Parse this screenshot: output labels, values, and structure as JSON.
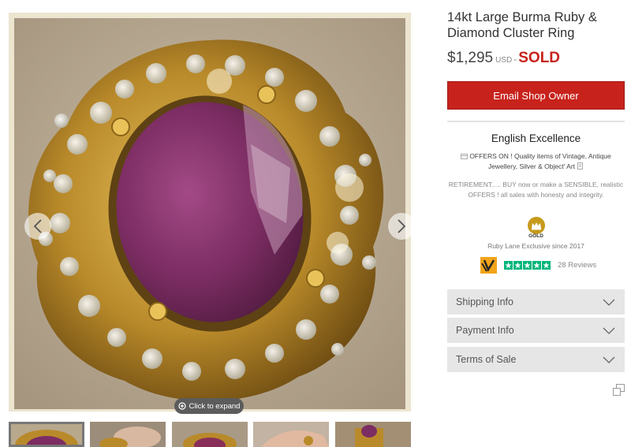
{
  "listing": {
    "title": "14kt Large Burma Ruby & Diamond Cluster Ring",
    "price": "$1,295",
    "currency": "USD",
    "separator": "-",
    "status": "SOLD",
    "email_button": "Email Shop Owner"
  },
  "gallery": {
    "expand_label": "Click to expand",
    "prev_icon": "chevron-left-icon",
    "next_icon": "chevron-right-icon",
    "thumbnail_count": 5,
    "active_thumbnail": 1
  },
  "shop": {
    "name": "English Excellence",
    "tagline": "OFFERS ON ! Quality items of Vintage, Antique Jewellery, Silver & Object' Art",
    "description": "RETIREMENT..... BUY now or make a SENSIBLE, realistic OFFERS ! all sales with honesty and integrity.",
    "badge": "GOLD",
    "badge_icon": "crown-icon",
    "exclusive": "Ruby Lane Exclusive since 2017",
    "rating_stars": 5,
    "reviews": "28 Reviews"
  },
  "accordion": [
    {
      "label": "Shipping Info"
    },
    {
      "label": "Payment Info"
    },
    {
      "label": "Terms of Sale"
    }
  ],
  "colors": {
    "accent_red": "#c8221c",
    "star_green": "#00b67a",
    "gold": "#c79a1c",
    "panel_gray": "#e6e6e6"
  }
}
